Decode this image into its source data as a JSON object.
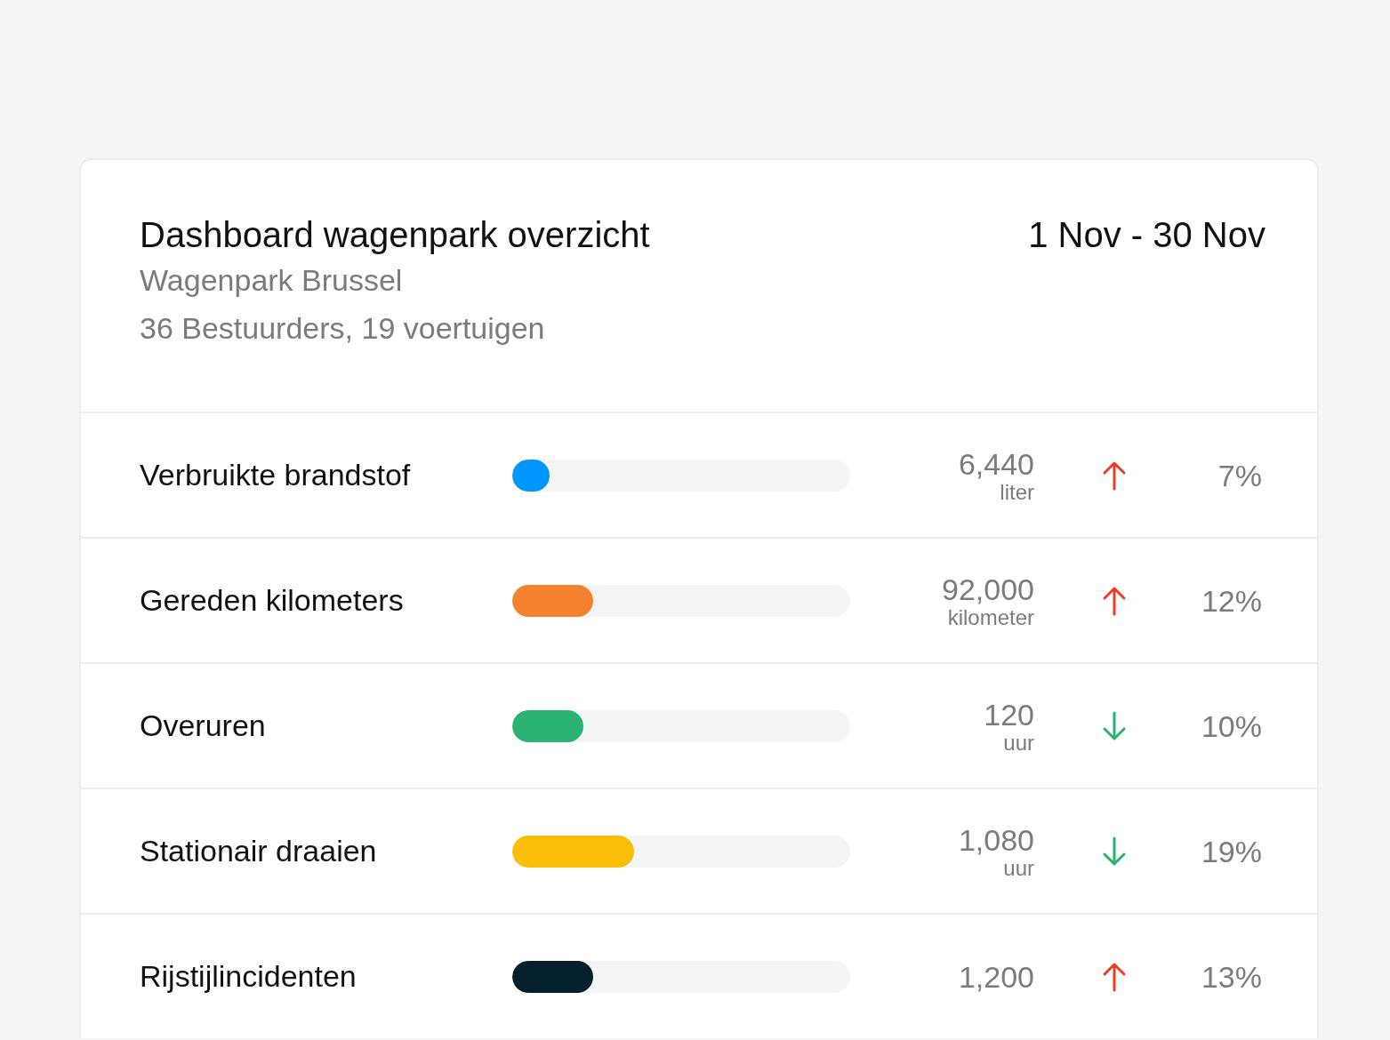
{
  "header": {
    "title": "Dashboard wagenpark overzicht",
    "subtitle": "Wagenpark Brussel",
    "details": "36 Bestuurders, 19 voertuigen",
    "period": "1 Nov - 30 Nov"
  },
  "metrics": [
    {
      "label": "Verbruikte brandstof",
      "level": 0.11,
      "color": "#0096ff",
      "value": "6,440",
      "unit": "liter",
      "increase": true,
      "change": "7%"
    },
    {
      "label": "Gereden kilometers",
      "level": 0.24,
      "color": "#f5802d",
      "value": "92,000",
      "unit": "kilometer",
      "increase": true,
      "change": "12%"
    },
    {
      "label": "Overuren",
      "level": 0.21,
      "color": "#2bb273",
      "value": "120",
      "unit": "uur",
      "increase": false,
      "change": "10%"
    },
    {
      "label": "Stationair draaien",
      "level": 0.36,
      "color": "#fabd05",
      "value": "1,080",
      "unit": "uur",
      "increase": false,
      "change": "19%"
    },
    {
      "label": "Rijstijlincidenten",
      "level": 0.24,
      "color": "#03202c",
      "value": "1,200",
      "increase": true,
      "change": "13%"
    }
  ]
}
